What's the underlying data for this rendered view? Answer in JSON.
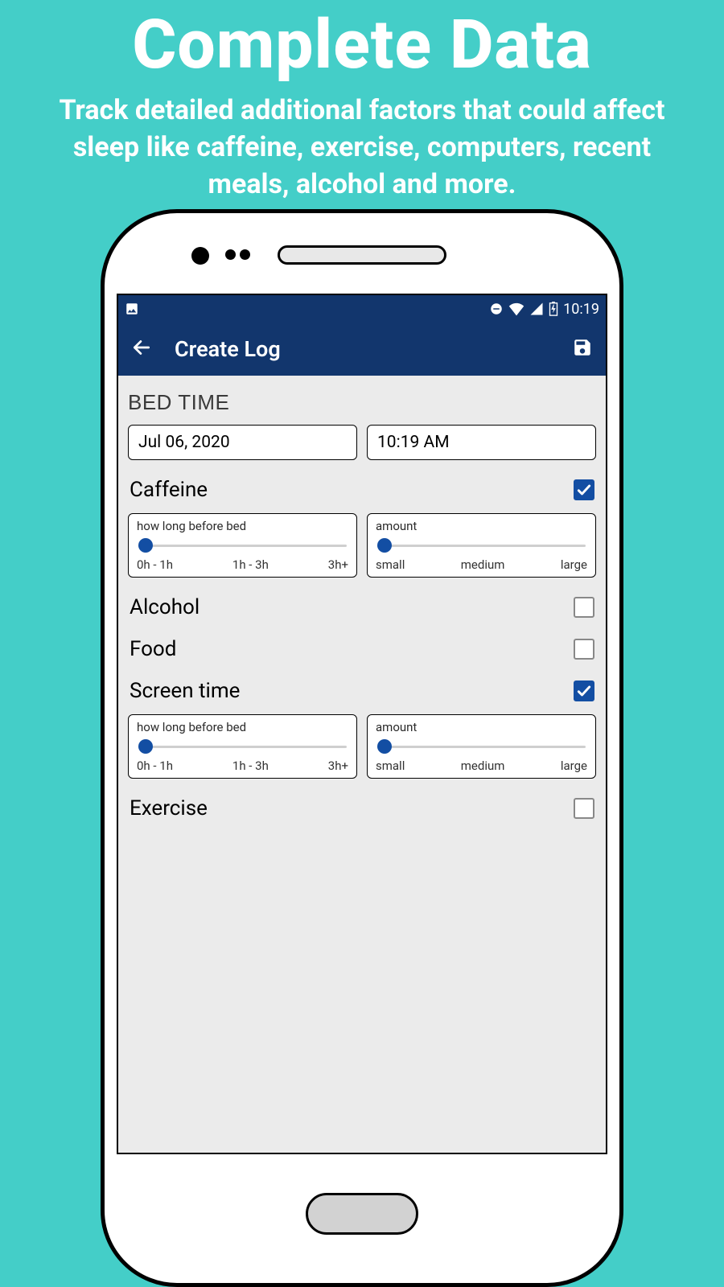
{
  "promo": {
    "headline": "Complete Data",
    "subhead": "Track detailed additional factors that could affect sleep like caffeine, exercise, computers, recent meals, alcohol and more."
  },
  "statusbar": {
    "time": "10:19"
  },
  "appbar": {
    "title": "Create Log"
  },
  "bedtime": {
    "label": "BED TIME",
    "date": "Jul 06, 2020",
    "time": "10:19 AM"
  },
  "slider_duration": {
    "title": "how long before bed",
    "ticks": [
      "0h - 1h",
      "1h - 3h",
      "3h+"
    ]
  },
  "slider_amount": {
    "title": "amount",
    "ticks": [
      "small",
      "medium",
      "large"
    ]
  },
  "factors": {
    "caffeine": {
      "label": "Caffeine",
      "checked": true
    },
    "alcohol": {
      "label": "Alcohol",
      "checked": false
    },
    "food": {
      "label": "Food",
      "checked": false
    },
    "screentime": {
      "label": "Screen time",
      "checked": true
    },
    "exercise": {
      "label": "Exercise",
      "checked": false
    }
  }
}
